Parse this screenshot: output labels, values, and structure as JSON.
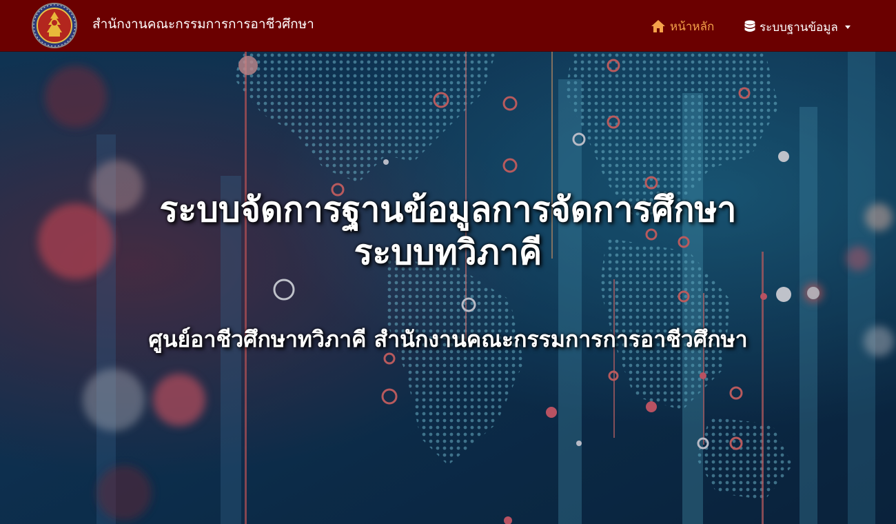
{
  "navbar": {
    "brand": "สำนักงานคณะกรรมการการอาชีวศึกษา",
    "home_label": "หน้าหลัก",
    "database_menu_label": "ระบบฐานข้อมูล",
    "home_icon": "home-icon",
    "database_icon": "database-icon",
    "dropdown_icon": "caret-down-icon",
    "logo_icon": "ovec-seal-logo"
  },
  "hero": {
    "title_line1": "ระบบจัดการฐานข้อมูลการจัดการศึกษา",
    "title_line2": "ระบบทวิภาคี",
    "subtitle": "ศูนย์อาชีวศึกษาทวิภาคี สำนักงานคณะกรรมการการอาชีวศึกษา"
  },
  "colors": {
    "navbar_bg": "#6b0000",
    "home_link": "#f5a24a",
    "nav_text": "#ffffff",
    "hero_text": "#ffffff"
  }
}
